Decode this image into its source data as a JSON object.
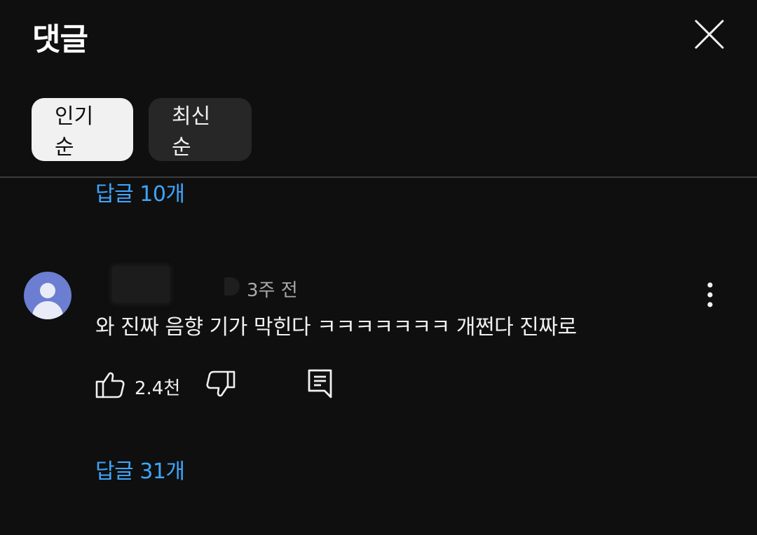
{
  "header": {
    "title": "댓글",
    "close_icon": "close-icon"
  },
  "sort_chips": [
    {
      "label": "인기순",
      "selected": true
    },
    {
      "label": "최신순",
      "selected": false
    }
  ],
  "previous_thread": {
    "replies_label": "답글 10개"
  },
  "comment": {
    "timestamp": "3주 전",
    "text": "와 진짜 음향 기가 막힌다 ㅋㅋㅋㅋㅋㅋㅋ 개쩐다 진짜로",
    "like_count": "2.4천",
    "replies_label": "답글 31개",
    "icons": {
      "avatar": "default-user-avatar",
      "more": "more-vertical-icon",
      "like": "thumbs-up-icon",
      "dislike": "thumbs-down-icon",
      "reply": "comment-reply-icon"
    }
  },
  "colors": {
    "background": "#0f0f0f",
    "link": "#3ea6ff",
    "chip_selected": "#f1f1f1",
    "chip_unselected": "#272727",
    "avatar": "#6c7ed1"
  }
}
